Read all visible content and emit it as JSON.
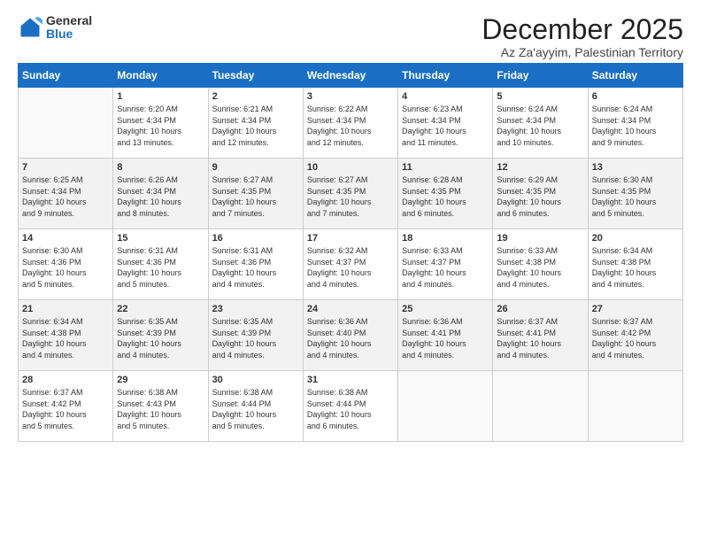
{
  "logo": {
    "general": "General",
    "blue": "Blue"
  },
  "header": {
    "month": "December 2025",
    "location": "Az Za'ayyim, Palestinian Territory"
  },
  "days_of_week": [
    "Sunday",
    "Monday",
    "Tuesday",
    "Wednesday",
    "Thursday",
    "Friday",
    "Saturday"
  ],
  "weeks": [
    [
      {
        "num": "",
        "info": ""
      },
      {
        "num": "1",
        "info": "Sunrise: 6:20 AM\nSunset: 4:34 PM\nDaylight: 10 hours\nand 13 minutes."
      },
      {
        "num": "2",
        "info": "Sunrise: 6:21 AM\nSunset: 4:34 PM\nDaylight: 10 hours\nand 12 minutes."
      },
      {
        "num": "3",
        "info": "Sunrise: 6:22 AM\nSunset: 4:34 PM\nDaylight: 10 hours\nand 12 minutes."
      },
      {
        "num": "4",
        "info": "Sunrise: 6:23 AM\nSunset: 4:34 PM\nDaylight: 10 hours\nand 11 minutes."
      },
      {
        "num": "5",
        "info": "Sunrise: 6:24 AM\nSunset: 4:34 PM\nDaylight: 10 hours\nand 10 minutes."
      },
      {
        "num": "6",
        "info": "Sunrise: 6:24 AM\nSunset: 4:34 PM\nDaylight: 10 hours\nand 9 minutes."
      }
    ],
    [
      {
        "num": "7",
        "info": "Sunrise: 6:25 AM\nSunset: 4:34 PM\nDaylight: 10 hours\nand 9 minutes."
      },
      {
        "num": "8",
        "info": "Sunrise: 6:26 AM\nSunset: 4:34 PM\nDaylight: 10 hours\nand 8 minutes."
      },
      {
        "num": "9",
        "info": "Sunrise: 6:27 AM\nSunset: 4:35 PM\nDaylight: 10 hours\nand 7 minutes."
      },
      {
        "num": "10",
        "info": "Sunrise: 6:27 AM\nSunset: 4:35 PM\nDaylight: 10 hours\nand 7 minutes."
      },
      {
        "num": "11",
        "info": "Sunrise: 6:28 AM\nSunset: 4:35 PM\nDaylight: 10 hours\nand 6 minutes."
      },
      {
        "num": "12",
        "info": "Sunrise: 6:29 AM\nSunset: 4:35 PM\nDaylight: 10 hours\nand 6 minutes."
      },
      {
        "num": "13",
        "info": "Sunrise: 6:30 AM\nSunset: 4:35 PM\nDaylight: 10 hours\nand 5 minutes."
      }
    ],
    [
      {
        "num": "14",
        "info": "Sunrise: 6:30 AM\nSunset: 4:36 PM\nDaylight: 10 hours\nand 5 minutes."
      },
      {
        "num": "15",
        "info": "Sunrise: 6:31 AM\nSunset: 4:36 PM\nDaylight: 10 hours\nand 5 minutes."
      },
      {
        "num": "16",
        "info": "Sunrise: 6:31 AM\nSunset: 4:36 PM\nDaylight: 10 hours\nand 4 minutes."
      },
      {
        "num": "17",
        "info": "Sunrise: 6:32 AM\nSunset: 4:37 PM\nDaylight: 10 hours\nand 4 minutes."
      },
      {
        "num": "18",
        "info": "Sunrise: 6:33 AM\nSunset: 4:37 PM\nDaylight: 10 hours\nand 4 minutes."
      },
      {
        "num": "19",
        "info": "Sunrise: 6:33 AM\nSunset: 4:38 PM\nDaylight: 10 hours\nand 4 minutes."
      },
      {
        "num": "20",
        "info": "Sunrise: 6:34 AM\nSunset: 4:38 PM\nDaylight: 10 hours\nand 4 minutes."
      }
    ],
    [
      {
        "num": "21",
        "info": "Sunrise: 6:34 AM\nSunset: 4:38 PM\nDaylight: 10 hours\nand 4 minutes."
      },
      {
        "num": "22",
        "info": "Sunrise: 6:35 AM\nSunset: 4:39 PM\nDaylight: 10 hours\nand 4 minutes."
      },
      {
        "num": "23",
        "info": "Sunrise: 6:35 AM\nSunset: 4:39 PM\nDaylight: 10 hours\nand 4 minutes."
      },
      {
        "num": "24",
        "info": "Sunrise: 6:36 AM\nSunset: 4:40 PM\nDaylight: 10 hours\nand 4 minutes."
      },
      {
        "num": "25",
        "info": "Sunrise: 6:36 AM\nSunset: 4:41 PM\nDaylight: 10 hours\nand 4 minutes."
      },
      {
        "num": "26",
        "info": "Sunrise: 6:37 AM\nSunset: 4:41 PM\nDaylight: 10 hours\nand 4 minutes."
      },
      {
        "num": "27",
        "info": "Sunrise: 6:37 AM\nSunset: 4:42 PM\nDaylight: 10 hours\nand 4 minutes."
      }
    ],
    [
      {
        "num": "28",
        "info": "Sunrise: 6:37 AM\nSunset: 4:42 PM\nDaylight: 10 hours\nand 5 minutes."
      },
      {
        "num": "29",
        "info": "Sunrise: 6:38 AM\nSunset: 4:43 PM\nDaylight: 10 hours\nand 5 minutes."
      },
      {
        "num": "30",
        "info": "Sunrise: 6:38 AM\nSunset: 4:44 PM\nDaylight: 10 hours\nand 5 minutes."
      },
      {
        "num": "31",
        "info": "Sunrise: 6:38 AM\nSunset: 4:44 PM\nDaylight: 10 hours\nand 6 minutes."
      },
      {
        "num": "",
        "info": ""
      },
      {
        "num": "",
        "info": ""
      },
      {
        "num": "",
        "info": ""
      }
    ]
  ]
}
